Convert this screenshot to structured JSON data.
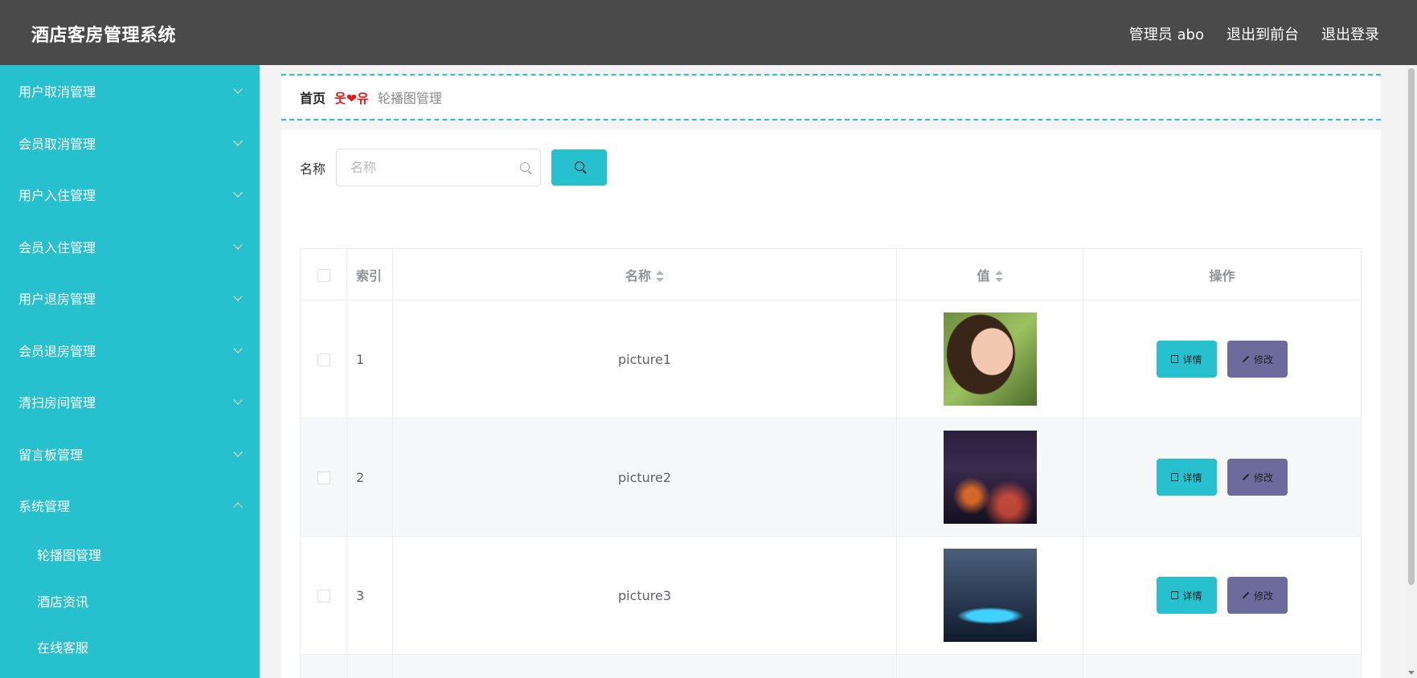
{
  "header": {
    "title": "酒店客房管理系统",
    "nav": [
      "管理员 abo",
      "退出到前台",
      "退出登录"
    ]
  },
  "sidebar": {
    "items": [
      {
        "label": "用户取消管理",
        "expanded": false
      },
      {
        "label": "会员取消管理",
        "expanded": false
      },
      {
        "label": "用户入住管理",
        "expanded": false
      },
      {
        "label": "会员入住管理",
        "expanded": false
      },
      {
        "label": "用户退房管理",
        "expanded": false
      },
      {
        "label": "会员退房管理",
        "expanded": false
      },
      {
        "label": "清扫房间管理",
        "expanded": false
      },
      {
        "label": "留言板管理",
        "expanded": false
      },
      {
        "label": "系统管理",
        "expanded": true
      }
    ],
    "subitems": [
      "轮播图管理",
      "酒店资讯",
      "在线客服"
    ]
  },
  "breadcrumb": {
    "home": "首页",
    "separator": "웃❤유",
    "current": "轮播图管理"
  },
  "search": {
    "label": "名称",
    "placeholder": "名称"
  },
  "table": {
    "headers": {
      "index": "索引",
      "name": "名称",
      "value": "值",
      "ops": "操作"
    },
    "rows": [
      {
        "index": "1",
        "name": "picture1",
        "thumb": "portrait-photo"
      },
      {
        "index": "2",
        "name": "picture2",
        "thumb": "city-night-photo"
      },
      {
        "index": "3",
        "name": "picture3",
        "thumb": "bridge-night-photo"
      }
    ],
    "detail_label": "详情",
    "edit_label": "修改"
  },
  "colors": {
    "accent": "#26c0cf",
    "header_bg": "#4a4a4a",
    "edit_btn": "#6d6b9e"
  }
}
